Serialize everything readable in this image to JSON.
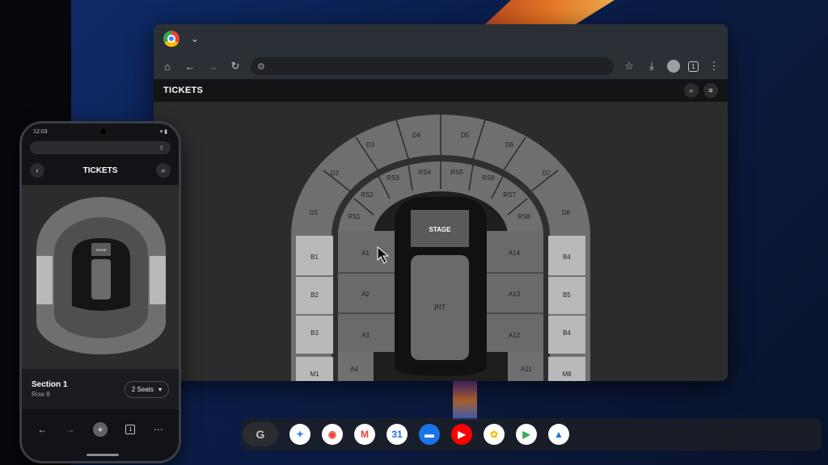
{
  "browser": {
    "toolbar_icons": [
      "home-icon",
      "back-icon",
      "forward-icon",
      "reload-icon",
      "site-info-icon"
    ],
    "right_icons": [
      "star-icon",
      "download-icon",
      "profile-icon",
      "tab-count-icon",
      "more-icon"
    ],
    "tab_count": "1"
  },
  "site": {
    "title": "TICKETS",
    "stage_label": "STAGE",
    "pit_label": "PIT",
    "sections": {
      "outer": [
        "D1",
        "D2",
        "D3",
        "D4",
        "D5",
        "D6",
        "D7",
        "D8"
      ],
      "rs": [
        "RS1",
        "RS2",
        "RS3",
        "RS4",
        "RS5",
        "RS6",
        "RS7",
        "RS8"
      ],
      "left_b": [
        "B1",
        "B2",
        "B3"
      ],
      "right_b": [
        "B4",
        "B5",
        "B4"
      ],
      "left_a": [
        "A1",
        "A2",
        "A3",
        "A4"
      ],
      "right_a": [
        "A14",
        "A13",
        "A12",
        "A11"
      ],
      "m": [
        "M1",
        "M8"
      ]
    }
  },
  "phone": {
    "time": "12:03",
    "title": "TICKETS",
    "stage_label": "STAGE",
    "section_name": "Section 1",
    "row": "Row 8",
    "seats_label": "2 Seats",
    "tab_count": "1"
  },
  "shelf": {
    "launcher": "G",
    "apps": [
      {
        "name": "gemini",
        "color": "#ffffff",
        "glyph": "✦",
        "fg": "#4285f4"
      },
      {
        "name": "chrome",
        "color": "#ffffff",
        "glyph": "◉",
        "fg": "#ea4335"
      },
      {
        "name": "gmail",
        "color": "#ffffff",
        "glyph": "M",
        "fg": "#ea4335"
      },
      {
        "name": "calendar",
        "color": "#ffffff",
        "glyph": "31",
        "fg": "#1a73e8"
      },
      {
        "name": "files",
        "color": "#1a73e8",
        "glyph": "▬",
        "fg": "#ffffff"
      },
      {
        "name": "youtube",
        "color": "#ff0000",
        "glyph": "▶",
        "fg": "#ffffff"
      },
      {
        "name": "photos",
        "color": "#ffffff",
        "glyph": "✿",
        "fg": "#fbbc05"
      },
      {
        "name": "play-store",
        "color": "#ffffff",
        "glyph": "▶",
        "fg": "#34a853"
      },
      {
        "name": "drive",
        "color": "#ffffff",
        "glyph": "▲",
        "fg": "#1a73e8"
      }
    ]
  }
}
